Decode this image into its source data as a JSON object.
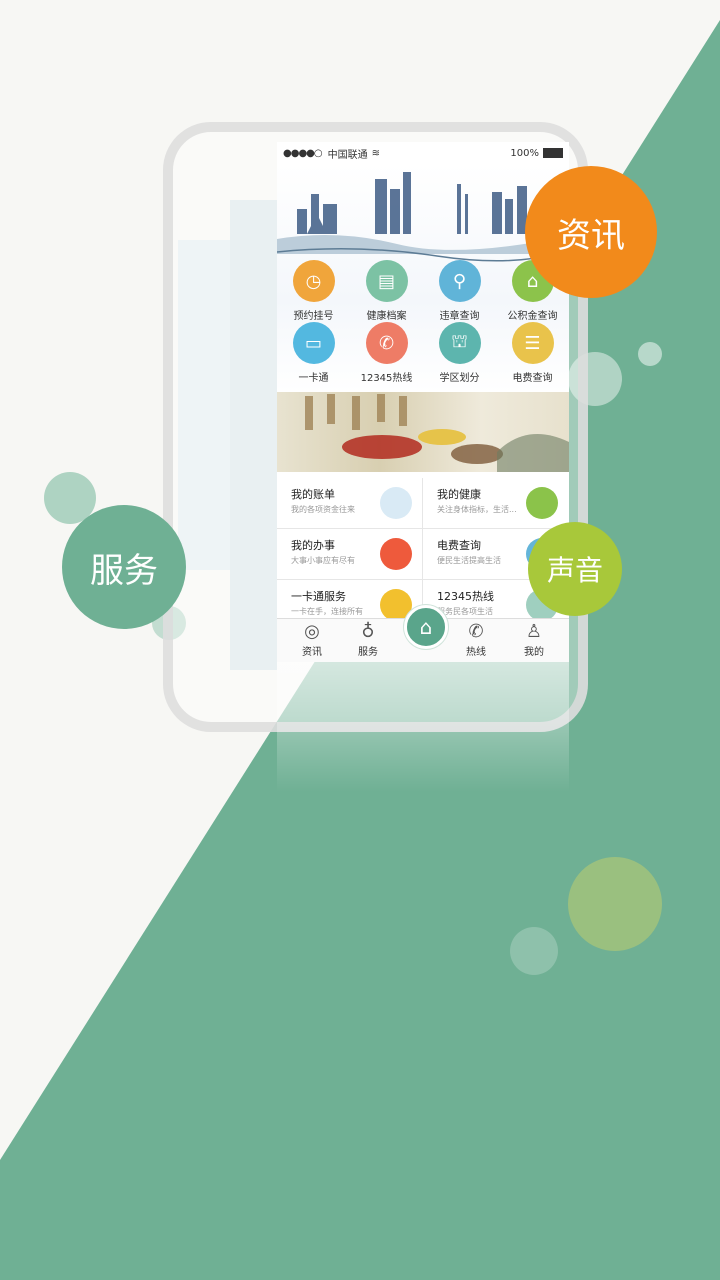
{
  "colors": {
    "green": "#6fb094",
    "orange": "#f28a1b",
    "lime": "#a8c83a",
    "teal": "#5aa58b"
  },
  "badges": {
    "news": "资讯",
    "service": "服务",
    "voice": "声音"
  },
  "status_bar": {
    "signal": "●●●●○",
    "carrier": "中国联通",
    "battery": "100%"
  },
  "grid": [
    {
      "label": "预约挂号",
      "icon": "clock-icon",
      "color": "#f0a53b"
    },
    {
      "label": "健康档案",
      "icon": "folder-icon",
      "color": "#7cc2a4"
    },
    {
      "label": "违章查询",
      "icon": "car-search-icon",
      "color": "#60b4d8"
    },
    {
      "label": "公积金查询",
      "icon": "house-person-icon",
      "color": "#8cc34b"
    },
    {
      "label": "一卡通",
      "icon": "card-icon",
      "color": "#53b8e0"
    },
    {
      "label": "12345热线",
      "icon": "phone-icon",
      "color": "#ee7c66"
    },
    {
      "label": "学区划分",
      "icon": "school-icon",
      "color": "#5db5ae"
    },
    {
      "label": "电费查询",
      "icon": "bill-icon",
      "color": "#e9c34b"
    }
  ],
  "cards": [
    {
      "title": "我的账单",
      "sub": "我的各项资金往来",
      "icon": "bill-illustration-icon"
    },
    {
      "title": "我的健康",
      "sub": "关注身体指标，生活...",
      "icon": "lightning-icon"
    },
    {
      "title": "我的办事",
      "sub": "大事小事应有尽有",
      "icon": "balloon-icon"
    },
    {
      "title": "电费查询",
      "sub": "便民生活提高生活",
      "icon": "meter-icon"
    },
    {
      "title": "一卡通服务",
      "sub": "一卡在手，连接所有",
      "icon": "cards-icon"
    },
    {
      "title": "12345热线",
      "sub": "服务民各项生活",
      "icon": "headset-icon"
    }
  ],
  "tabs": [
    {
      "label": "资讯",
      "icon": "globe-icon"
    },
    {
      "label": "服务",
      "icon": "bulb-icon"
    },
    {
      "label": "",
      "icon": "home-icon"
    },
    {
      "label": "热线",
      "icon": "phone-icon"
    },
    {
      "label": "我的",
      "icon": "person-icon"
    }
  ]
}
